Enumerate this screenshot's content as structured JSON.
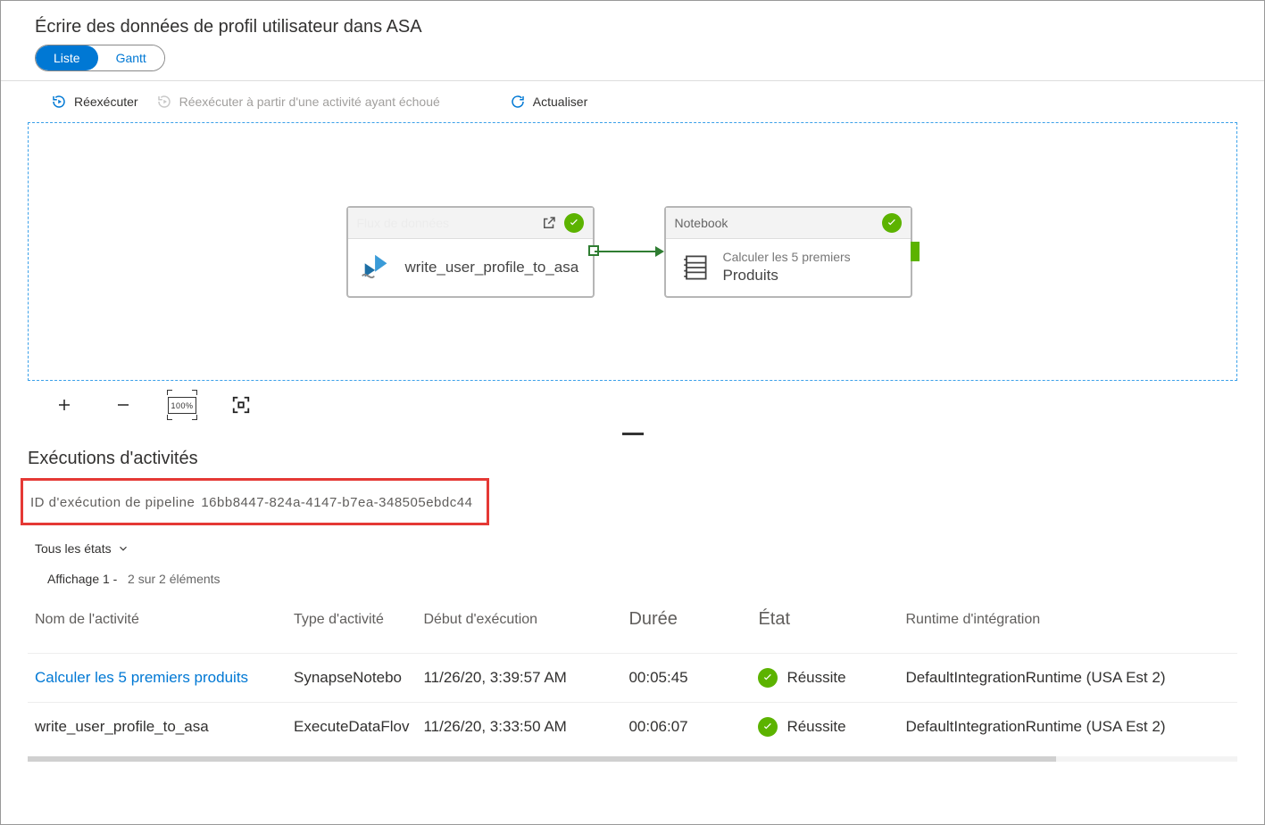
{
  "page_title": "Écrire des données de profil utilisateur dans ASA",
  "view_toggle": {
    "list": "Liste",
    "gantt": "Gantt"
  },
  "actions": {
    "rerun": "Réexécuter",
    "rerun_failed": "Réexécuter à partir d'une activité ayant échoué",
    "refresh": "Actualiser"
  },
  "nodes": {
    "dataflow": {
      "header": "Flux de données",
      "title": "write_user_profile_to_asa"
    },
    "notebook": {
      "header": "Notebook",
      "title_line1": "Calculer les 5 premiers",
      "title_line2": "Produits"
    }
  },
  "zoom_pct": "100%",
  "activity_section_title": "Exécutions d'activités",
  "pipeline_run": {
    "label": "ID d'exécution de pipeline",
    "id": "16bb8447-824a-4147-b7ea-348505ebdc44"
  },
  "filter_label": "Tous les états",
  "display_count": {
    "prefix": "Affichage 1 -",
    "suffix": "2 sur 2 éléments"
  },
  "columns": {
    "activity_name": "Nom de l'activité",
    "activity_type": "Type d'activité",
    "run_start": "Début d'exécution",
    "duration": "Durée",
    "status": "État",
    "integration_runtime": "Runtime d'intégration"
  },
  "status_success": "Réussite",
  "rows": [
    {
      "name": "Calculer les 5 premiers produits",
      "type": "SynapseNotebo",
      "start": "11/26/20, 3:39:57 AM",
      "duration": "00:05:45",
      "runtime": "DefaultIntegrationRuntime (USA Est 2)",
      "link": true
    },
    {
      "name": "write_user_profile_to_asa",
      "type": "ExecuteDataFlov",
      "start": "11/26/20, 3:33:50 AM",
      "duration": "00:06:07",
      "runtime": "DefaultIntegrationRuntime (USA Est 2)",
      "link": false
    }
  ]
}
